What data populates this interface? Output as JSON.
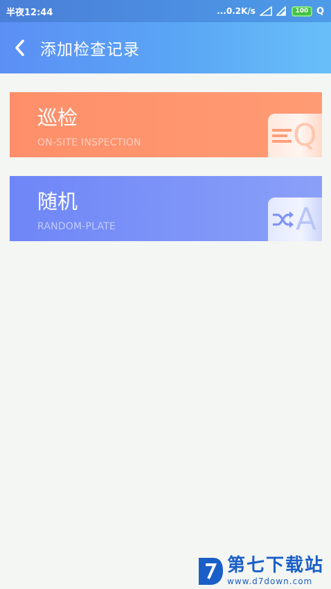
{
  "status_bar": {
    "time": "半夜12:44",
    "network_speed": "...0.2K/s",
    "battery": "100",
    "icons": [
      "signal-icon",
      "signal-icon-2",
      "battery-icon",
      "app-q-icon"
    ],
    "app_icon_letter": "Q"
  },
  "header": {
    "title": "添加检查记录",
    "back_icon": "chevron-left-icon"
  },
  "cards": [
    {
      "title": "巡检",
      "subtitle": "ON-SITE INSPECTION",
      "badge_icon": "list-icon",
      "badge_letter": "Q",
      "color": "#fe8f6a"
    },
    {
      "title": "随机",
      "subtitle": "RANDOM-PLATE",
      "badge_icon": "shuffle-icon",
      "badge_letter": "A",
      "color": "#6e86f7"
    }
  ],
  "watermark": {
    "text": "第七下载站",
    "url": "www.d7down.com",
    "color": "#1a5fc8"
  }
}
